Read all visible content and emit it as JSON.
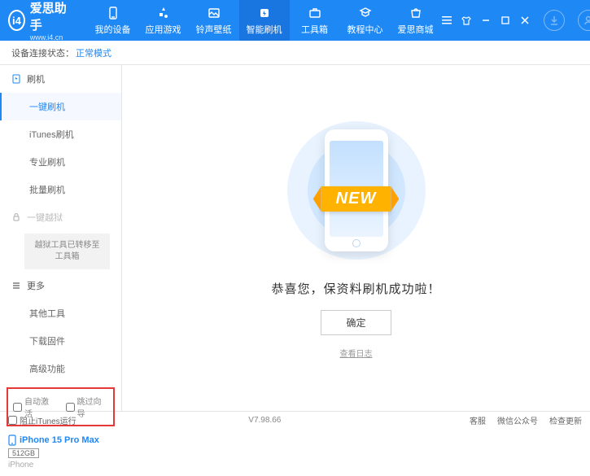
{
  "app": {
    "name": "爱思助手",
    "url": "www.i4.cn"
  },
  "nav": {
    "items": [
      {
        "label": "我的设备"
      },
      {
        "label": "应用游戏"
      },
      {
        "label": "铃声壁纸"
      },
      {
        "label": "智能刷机"
      },
      {
        "label": "工具箱"
      },
      {
        "label": "教程中心"
      },
      {
        "label": "爱思商城"
      }
    ],
    "active_index": 3
  },
  "status": {
    "label": "设备连接状态：",
    "value": "正常模式"
  },
  "sidebar": {
    "groups": [
      {
        "icon": "flash",
        "label": "刷机",
        "subs": [
          {
            "label": "一键刷机",
            "active": true
          },
          {
            "label": "iTunes刷机"
          },
          {
            "label": "专业刷机"
          },
          {
            "label": "批量刷机"
          }
        ]
      },
      {
        "icon": "lock",
        "label": "一键越狱",
        "locked": true,
        "note": "越狱工具已转移至工具箱"
      },
      {
        "icon": "more",
        "label": "更多",
        "subs": [
          {
            "label": "其他工具"
          },
          {
            "label": "下载固件"
          },
          {
            "label": "高级功能"
          }
        ]
      }
    ],
    "checkboxes": [
      {
        "label": "自动激活"
      },
      {
        "label": "跳过向导"
      }
    ]
  },
  "device": {
    "name": "iPhone 15 Pro Max",
    "storage": "512GB",
    "type": "iPhone"
  },
  "main": {
    "ribbon": "NEW",
    "message": "恭喜您，保资料刷机成功啦！",
    "ok": "确定",
    "log": "查看日志"
  },
  "footer": {
    "block_itunes": "阻止iTunes运行",
    "version": "V7.98.66",
    "links": [
      "客服",
      "微信公众号",
      "检查更新"
    ]
  }
}
